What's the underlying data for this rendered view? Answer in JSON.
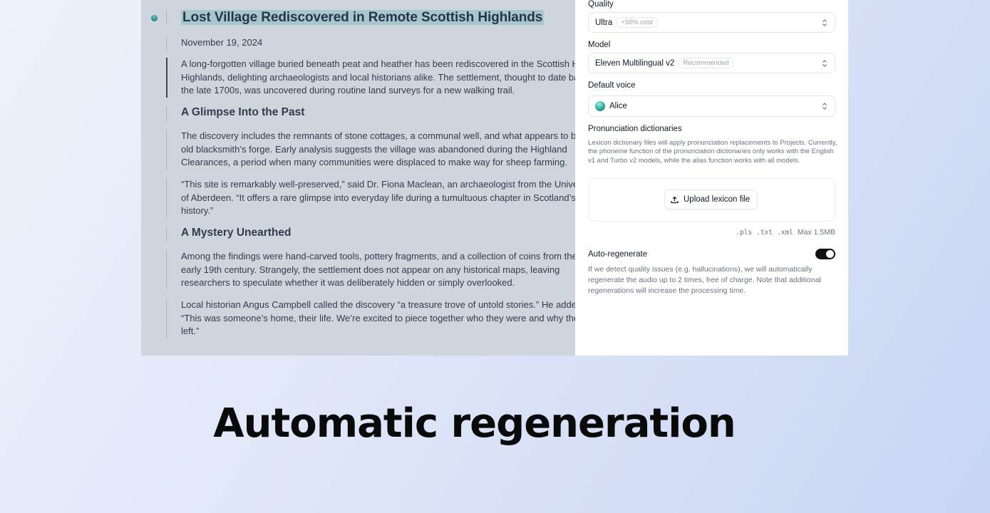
{
  "article": {
    "title": "Lost Village Rediscovered in Remote Scottish Highlands",
    "date": "November 19, 2024",
    "p1": [
      "A long-forgotten village buried beneath peat and heather has been rediscovered in the Scottish Highlands,",
      "Highlands, delighting archaeologists and local historians alike. The settlement, thought to date back to",
      "the late 1700s, was uncovered during routine land surveys for a new walking trail."
    ],
    "h1": "A Glimpse Into the Past",
    "p2": [
      "The discovery includes the remnants of stone cottages, a communal well, and what appears to be an",
      "old blacksmith’s forge. Early analysis suggests the village was abandoned during the Highland",
      "Clearances, a period when many communities were displaced to make way for sheep farming."
    ],
    "p3": [
      "“This site is remarkably well-preserved,” said Dr. Fiona Maclean, an archaeologist from the University",
      "of Aberdeen. “It offers a rare glimpse into everyday life during a tumultuous chapter in Scotland’s",
      "history.”"
    ],
    "h2": "A Mystery Unearthed",
    "p4": [
      "Among the findings were hand-carved tools, pottery fragments, and a collection of coins from the",
      "early 19th century. Strangely, the settlement does not appear on any historical maps, leaving",
      "researchers to speculate whether it was deliberately hidden or simply overlooked."
    ],
    "p5": [
      "Local historian Angus Campbell called the discovery “a treasure trove of untold stories.” He added,",
      "“This was someone’s home, their life. We’re excited to piece together who they were and why they",
      "left.”"
    ]
  },
  "settings": {
    "quality_label": "Quality",
    "quality_value": "Ultra",
    "quality_badge": "+50% cost",
    "model_label": "Model",
    "model_value": "Eleven Multilingual v2",
    "model_badge": "Recommended",
    "voice_label": "Default voice",
    "voice_value": "Alice",
    "dict_label": "Pronunciation dictionaries",
    "dict_help": "Lexicon dictionary files will apply pronunciation replacements to Projects. Currently, the phoneme function of the pronunciation dictionaries only works with the English v1 and Turbo v2 models, while the alias function works with all models.",
    "upload_label": "Upload lexicon file",
    "filetypes": [
      ".pls",
      ".txt",
      ".xml"
    ],
    "max_size": "Max 1.5MB",
    "auto_label": "Auto-regenerate",
    "auto_enabled": true,
    "auto_help": "If we detect quality issues (e.g. hallucinations), we will automatically regenerate the audio up to 2 times, free of charge. Note that additional regenerations will increase the processing time."
  },
  "caption": "Automatic regeneration"
}
